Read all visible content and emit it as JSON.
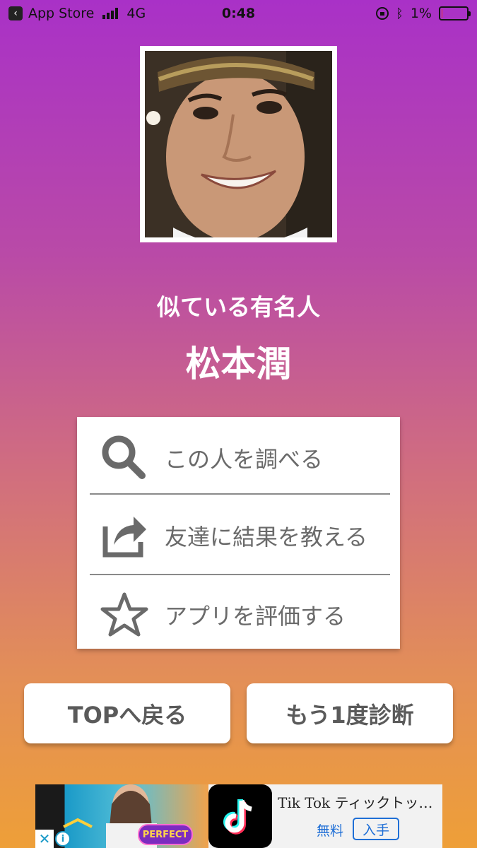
{
  "status_bar": {
    "back_app": "App Store",
    "network": "4G",
    "time": "0:48",
    "battery_text": "1%",
    "battery_level": 0.01
  },
  "result": {
    "label": "似ている有名人",
    "celebrity_name": "松本潤"
  },
  "menu": {
    "items": [
      {
        "label": "この人を調べる",
        "icon": "search-icon"
      },
      {
        "label": "友達に結果を教える",
        "icon": "share-icon"
      },
      {
        "label": "アプリを評価する",
        "icon": "star-icon"
      }
    ]
  },
  "buttons": {
    "top": "TOPへ戻る",
    "retry": "もう1度診断"
  },
  "ad": {
    "badge": "PERFECT",
    "title": "Tik Tok ティックトッ…",
    "price": "無料",
    "get": "入手",
    "close": "✕",
    "info": "i"
  },
  "colors": {
    "gradient_top": "#a931c7",
    "gradient_bottom": "#ee9f38",
    "menu_text": "#6a6a6a",
    "button_text": "#5a5a5a",
    "ad_link": "#1f6fd6"
  }
}
